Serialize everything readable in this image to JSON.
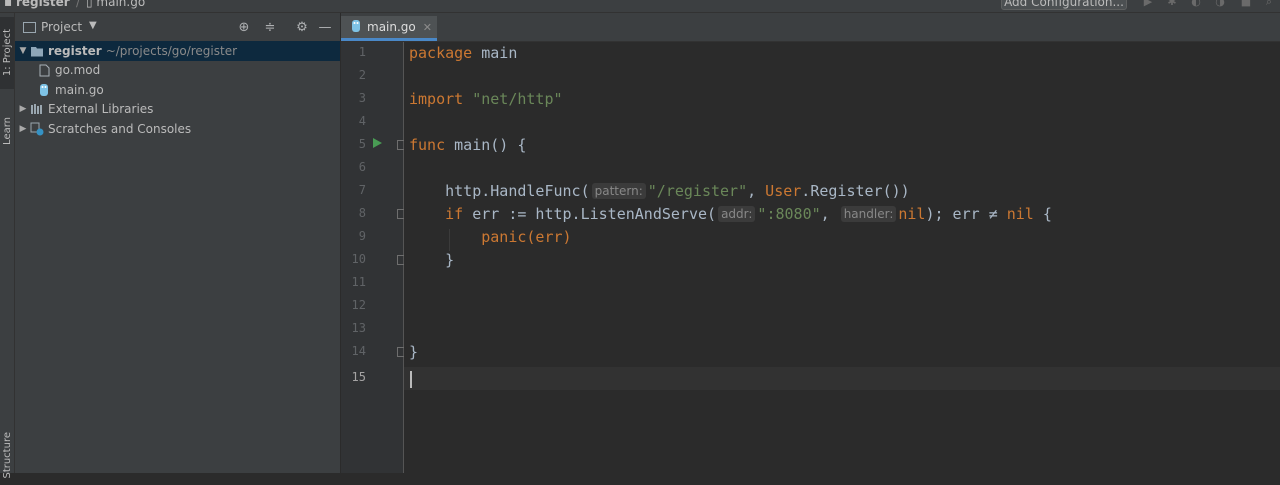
{
  "navbar": {
    "project": "register",
    "file": "main.go",
    "add_configuration": "Add Configuration..."
  },
  "stripe": {
    "project_tab": "1: Project",
    "learn_tab": "Learn",
    "structure_tab": "Structure"
  },
  "project_panel": {
    "title": "Project",
    "tree": {
      "root": {
        "name": "register",
        "path": "~/projects/go/register"
      },
      "files": [
        "go.mod",
        "main.go"
      ],
      "external_libraries": "External Libraries",
      "scratches": "Scratches and Consoles"
    }
  },
  "editor": {
    "tab_label": "main.go",
    "current_line": 15,
    "hints": {
      "pattern": "pattern:",
      "addr": "addr:",
      "handler": "handler:"
    },
    "lines": {
      "l1_kw": "package",
      "l1_id": " main",
      "l3_kw": "import",
      "l3_str": " \"net/http\"",
      "l5_kw": "func",
      "l5_rest": " main() {",
      "l7_a": "    http.HandleFunc(",
      "l7_str": "\"/register\"",
      "l7_b": ", ",
      "l7_user": "User",
      "l7_c": ".Register())",
      "l8_kw": "    if",
      "l8_a": " err := http.ListenAndServe(",
      "l8_str": "\":8080\"",
      "l8_b": ", ",
      "l8_nil1": "nil",
      "l8_c": "); err ≠ ",
      "l8_nil2": "nil",
      "l8_d": " {",
      "l9": "        panic(err)",
      "l10": "    }",
      "l14": "}"
    },
    "line_numbers": [
      "1",
      "2",
      "3",
      "4",
      "5",
      "6",
      "7",
      "8",
      "9",
      "10",
      "11",
      "12",
      "13",
      "14",
      "15"
    ]
  }
}
